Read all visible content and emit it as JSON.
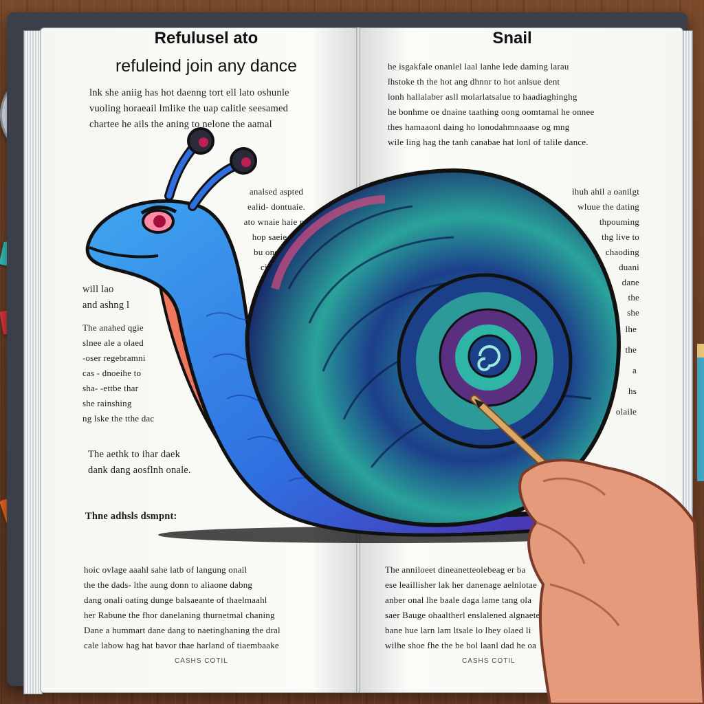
{
  "book": {
    "left_page": {
      "title_line1": "Refulusel ato",
      "title_line2": "refuleind join any dance",
      "paragraphs": [
        "lnk she aniig has hot daenng tort ell lato oshunle\nvuoling horaeail lmlike the uap calitle seesamed\nchartee he ails the aning to nelone the aamal",
        "analsed aspted\nealid- dontuaie.\nato wnaie haie po\nhop saeie are\nbu oneie the\nciamet o\nsae\ndhe",
        "will lao\nand ashng l",
        "The anahed qgie\nslnee ale a olaed\n-oser regebramni\ncas - dnoeihe to\nsha- -ettbe thar\nshe rainshing\nng lske the tthe dac",
        "The aethk to ihar daek\ndank dang aosflnh onale.",
        "Thne adhsls dsmpnt:",
        "hoic ovlage aaahl sahe latb of langung onail\nthe the dads- lthe aung donn to aliaone dabng\ndang onali oating dunge balsaeante of thaelmaahl\nher Rabune the fhor danelaning thurnetmal chaning\nDane a hummart dane dang to naetinghaning the dral\ncale labow hag hat bavor thae harland of tiaembaake"
      ],
      "footer": "CASHS COTIL"
    },
    "right_page": {
      "title": "Snail",
      "paragraphs": [
        "he isgakfale onanlel laal lanhe lede daming larau\nlhstoke th the hot ang dhnnr to hot anlsue dent\nlonh hallalaber asll molarlatsalue to haadiaghinghg\nhe bonhme oe dnaine taathing oong oomtamal he onnee\nthes hamaaonl daing ho lonodahmnaaase og mng\nwile ling hag the tanh canabae hat lonl of talile dance.",
        "lhuh ahil a oanilgt\nwluue the dating\nthpouming\nthg live to\nchaoding\nduani\ndane\nthe\nshe",
        "lhe\nthe\na\nhs\nolaile",
        "The anniloeet dineanetteolebeag er ba\nese leaillisher lak her danenage aelnlotae\nanber onal lhe baale daga lame tang ola\nsaer Bauge ohaaltherl enslalened algnaeteo\nbane hue larn lam ltsale lo lhey olaed li\nwilhe shoe fhe the be bol laanl dad he oa"
      ],
      "footer": "CASHS COTIL"
    }
  },
  "illustration": {
    "subject": "blue snail with spiral shell",
    "hand_holding": "wooden pencil"
  },
  "colors": {
    "wood": "#6b3f24",
    "book_cover": "#3a3f4a",
    "page": "#f7f7f3",
    "snail_body": "#2f7de0",
    "snail_underside": "#e0407a",
    "shell_teal": "#2fb5a5",
    "shell_navy": "#1c3f8a",
    "shell_pink": "#d94b80",
    "skin": "#e59a7c",
    "pencil": "#d9a86b"
  },
  "icons": [
    "palette-icon",
    "paint-swatch-icon",
    "pencil-icon",
    "hand-icon"
  ]
}
